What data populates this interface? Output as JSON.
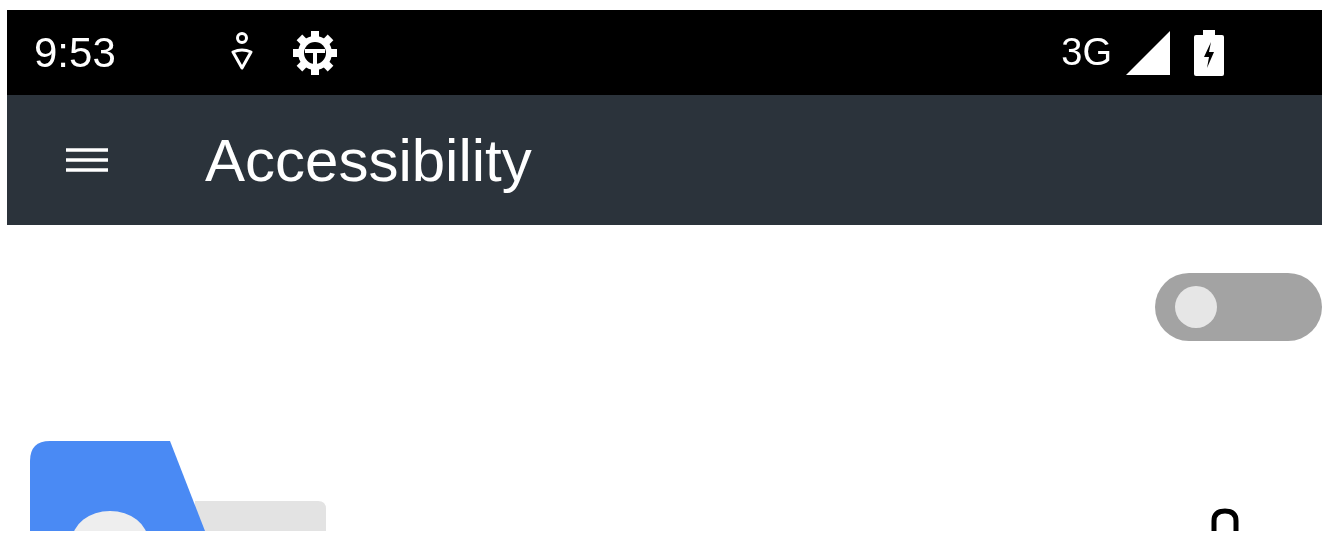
{
  "status_bar": {
    "time": "9:53",
    "network": "3G"
  },
  "toolbar": {
    "title": "Accessibility"
  },
  "toggle": {
    "on": false
  }
}
